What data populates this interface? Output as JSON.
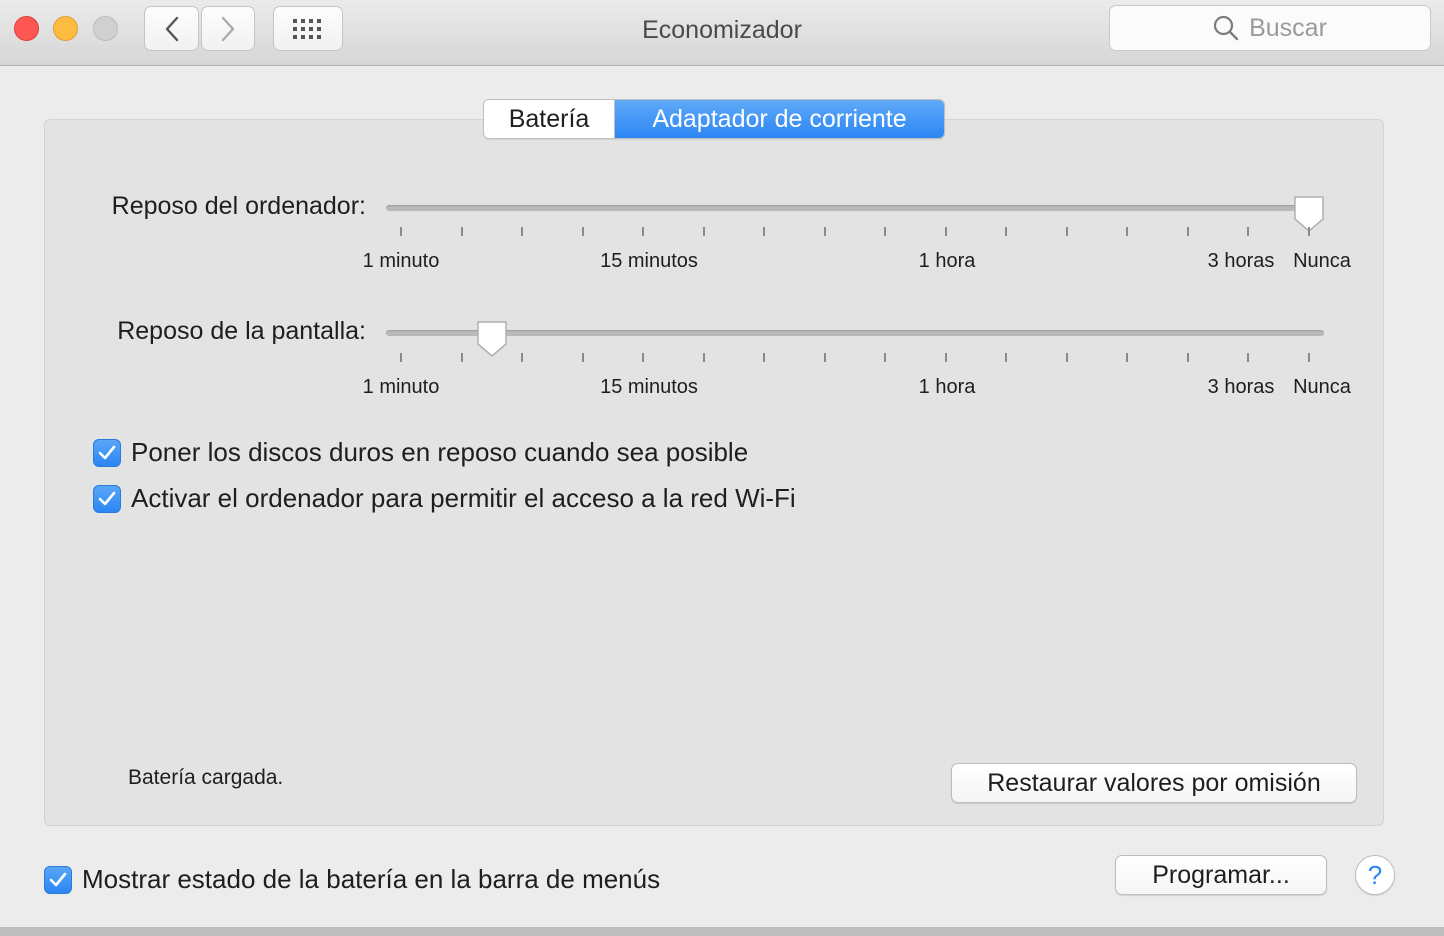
{
  "window": {
    "title": "Economizador",
    "search_placeholder": "Buscar"
  },
  "toolbar": {
    "back_icon": "chevron-left-icon",
    "forward_icon": "chevron-right-icon",
    "grid_icon": "show-all-grid-icon"
  },
  "tabs": [
    {
      "label": "Batería",
      "selected": false
    },
    {
      "label": "Adaptador de corriente",
      "selected": true
    }
  ],
  "sliders": {
    "computer_sleep": {
      "label": "Reposo del ordenador:",
      "value": "Nunca",
      "position": 1.0,
      "scale_labels": [
        "1 minuto",
        "15 minutos",
        "1 hora",
        "3 horas",
        "Nunca"
      ]
    },
    "display_sleep": {
      "label": "Reposo de la pantalla:",
      "value_fraction": 0.11,
      "scale_labels": [
        "1 minuto",
        "15 minutos",
        "1 hora",
        "3 horas",
        "Nunca"
      ]
    }
  },
  "options": [
    {
      "label": "Poner los discos duros en reposo cuando sea posible",
      "checked": true
    },
    {
      "label": "Activar el ordenador para permitir el acceso a la red Wi-Fi",
      "checked": true
    }
  ],
  "status": "Batería cargada.",
  "buttons": {
    "restore_defaults": "Restaurar valores por omisión",
    "schedule": "Programar...",
    "help": "?"
  },
  "menu_bar_option": {
    "label": "Mostrar estado de la batería en la barra de menús",
    "checked": true
  },
  "colors": {
    "accent": "#2c86f3",
    "close": "#fc5753",
    "minimize": "#fdbc40",
    "zoom_disabled": "#d0d0d0"
  }
}
